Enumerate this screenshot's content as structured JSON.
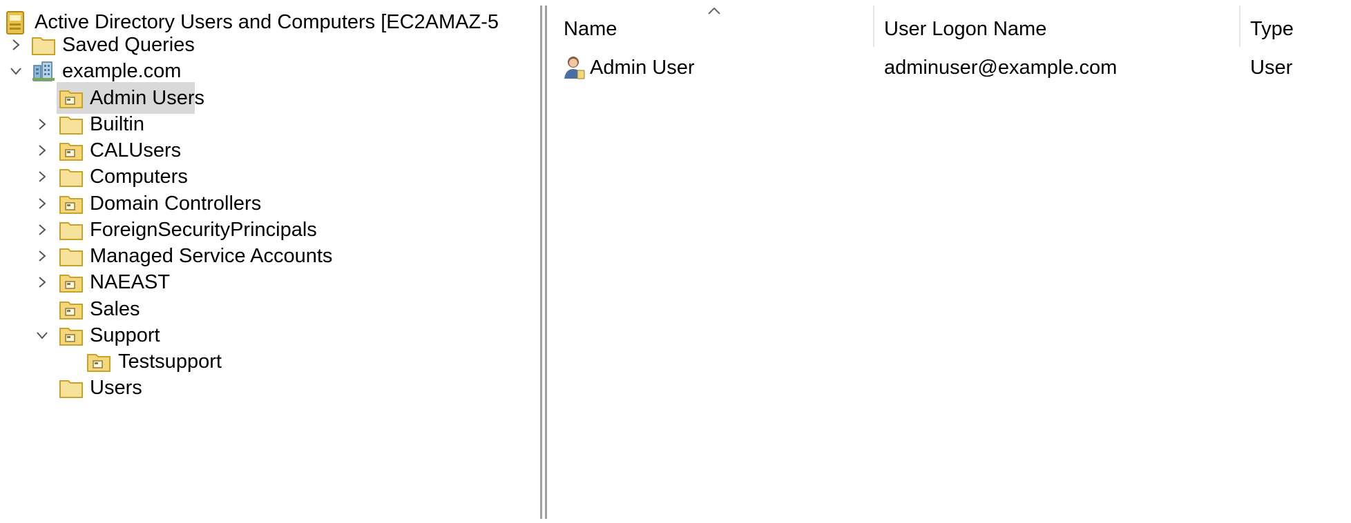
{
  "tree": {
    "root": {
      "label": "Active Directory Users and Computers [EC2AMAZ-5",
      "icon": "ad-console-icon"
    },
    "items": [
      {
        "label": "Saved Queries",
        "icon": "folder-icon",
        "expander": "collapsed"
      },
      {
        "label": "example.com",
        "icon": "domain-icon",
        "expander": "expanded"
      },
      {
        "label": "Admin Users",
        "icon": "ou-folder-icon",
        "expander": "none",
        "selected": true
      },
      {
        "label": "Builtin",
        "icon": "folder-icon",
        "expander": "collapsed"
      },
      {
        "label": "CALUsers",
        "icon": "ou-folder-icon",
        "expander": "collapsed"
      },
      {
        "label": "Computers",
        "icon": "folder-icon",
        "expander": "collapsed"
      },
      {
        "label": "Domain Controllers",
        "icon": "ou-folder-icon",
        "expander": "collapsed"
      },
      {
        "label": "ForeignSecurityPrincipals",
        "icon": "folder-icon",
        "expander": "collapsed"
      },
      {
        "label": "Managed Service Accounts",
        "icon": "folder-icon",
        "expander": "collapsed"
      },
      {
        "label": "NAEAST",
        "icon": "ou-folder-icon",
        "expander": "collapsed"
      },
      {
        "label": "Sales",
        "icon": "ou-folder-icon",
        "expander": "none"
      },
      {
        "label": "Support",
        "icon": "ou-folder-icon",
        "expander": "expanded"
      },
      {
        "label": "Testsupport",
        "icon": "ou-folder-icon",
        "expander": "none"
      },
      {
        "label": "Users",
        "icon": "folder-icon",
        "expander": "none"
      }
    ]
  },
  "list": {
    "columns": [
      "Name",
      "User Logon Name",
      "Type"
    ],
    "sort_column": "Name",
    "sort_direction": "ascending",
    "rows": [
      {
        "name": "Admin User",
        "logon": "adminuser@example.com",
        "type": "User",
        "icon": "user-icon"
      }
    ]
  },
  "colors": {
    "selection": "#d9d9d9",
    "folder": "#f3d77a",
    "folder_edge": "#c9a227",
    "chevron": "#555555"
  }
}
